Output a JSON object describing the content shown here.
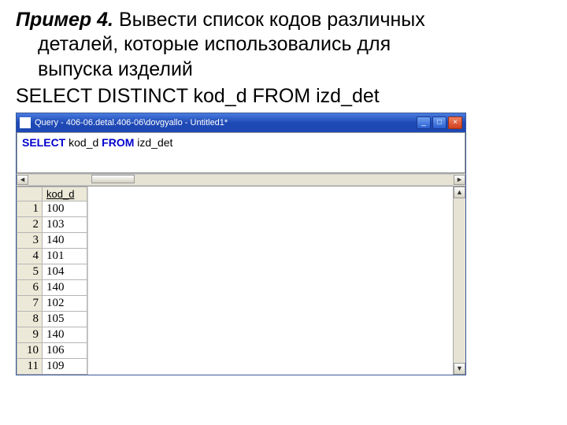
{
  "heading": {
    "example_label": "Пример 4.",
    "line1_rest": " Вывести список кодов различных",
    "line2": "деталей, которые использовались для",
    "line3": "выпуска изделий"
  },
  "outer_sql": "SELECT DISTINCT kod_d FROM izd_det",
  "window": {
    "title": "Query - 406-06.detal.406-06\\dovgyallo - Untitled1*",
    "min": "_",
    "max": "□",
    "close": "×"
  },
  "editor_sql": {
    "kw1": "SELECT",
    "col": " kod_d ",
    "kw2": "FROM",
    "tbl": " izd_det"
  },
  "grid": {
    "header": "kod_d",
    "rows": [
      {
        "n": "1",
        "v": "100"
      },
      {
        "n": "2",
        "v": "103"
      },
      {
        "n": "3",
        "v": "140"
      },
      {
        "n": "4",
        "v": "101"
      },
      {
        "n": "5",
        "v": "104"
      },
      {
        "n": "6",
        "v": "140"
      },
      {
        "n": "7",
        "v": "102"
      },
      {
        "n": "8",
        "v": "105"
      },
      {
        "n": "9",
        "v": "140"
      },
      {
        "n": "10",
        "v": "106"
      },
      {
        "n": "11",
        "v": "109"
      }
    ]
  },
  "arrows": {
    "left": "◄",
    "right": "►",
    "up": "▲",
    "down": "▼"
  }
}
